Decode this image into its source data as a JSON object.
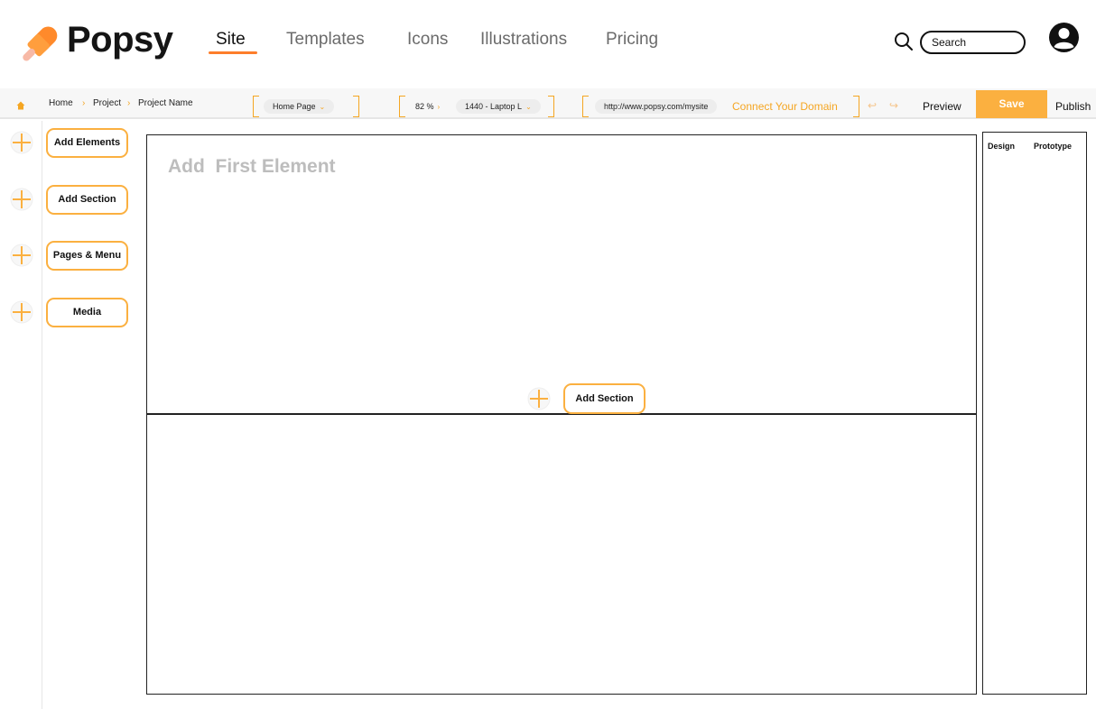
{
  "brand": {
    "name": "Popsy"
  },
  "nav": {
    "items": [
      {
        "label": "Site",
        "active": true
      },
      {
        "label": "Templates",
        "active": false
      },
      {
        "label": "Icons",
        "active": false
      },
      {
        "label": "Illustrations",
        "active": false
      },
      {
        "label": "Pricing",
        "active": false
      }
    ]
  },
  "search": {
    "placeholder": "Search"
  },
  "breadcrumb": [
    "Home",
    "Project",
    "Project Name"
  ],
  "toolbar": {
    "page_select": "Home Page",
    "zoom": "82 %",
    "viewport": "1440 - Laptop L",
    "url": "http://www.popsy.com/mysite",
    "connect_domain": "Connect Your Domain",
    "preview": "Preview",
    "save": "Save",
    "publish": "Publish"
  },
  "sidebar": {
    "items": [
      {
        "label": "Add Elements"
      },
      {
        "label": "Add Section"
      },
      {
        "label": "Pages & Menu"
      },
      {
        "label": "Media"
      }
    ]
  },
  "canvas": {
    "placeholder": "Add  First Element",
    "add_section": "Add Section"
  },
  "right_panel": {
    "tabs": [
      "Design",
      "Prototype"
    ]
  },
  "colors": {
    "accent": "#fbb040",
    "nav_underline": "#fd7e2b",
    "muted_text": "#bdbdbd"
  },
  "icons": [
    "popsicle-logo-icon",
    "search-icon",
    "user-avatar-icon",
    "home-icon",
    "chevron-right-icon",
    "chevron-down-icon",
    "undo-icon",
    "redo-icon",
    "plus-circle-icon"
  ]
}
